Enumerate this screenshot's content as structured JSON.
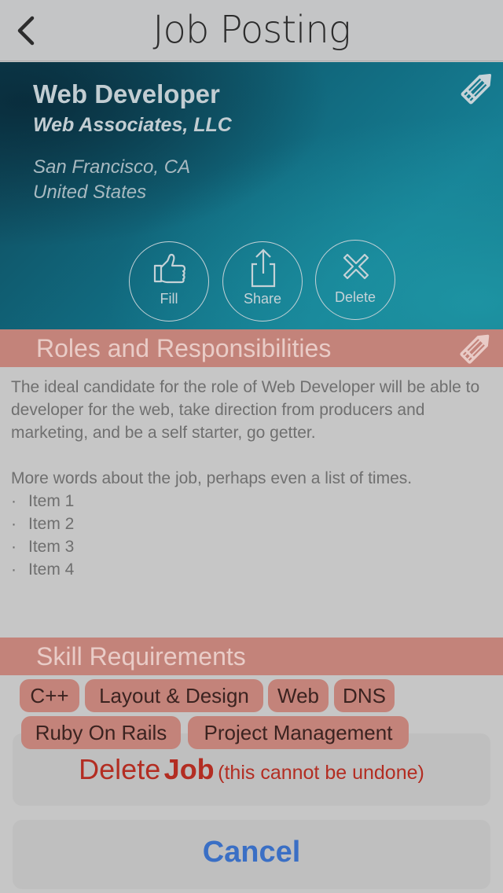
{
  "nav": {
    "title": "Job Posting",
    "back_icon": "chevron-left-icon"
  },
  "job": {
    "title": "Web Developer",
    "company": "Web Associates, LLC",
    "city": "San Francisco, CA",
    "country": "United States",
    "edit_icon": "pencil-icon"
  },
  "actions": [
    {
      "label": "Fill",
      "icon": "thumbs-up-icon"
    },
    {
      "label": "Share",
      "icon": "share-icon"
    },
    {
      "label": "Delete",
      "icon": "close-icon"
    }
  ],
  "roles": {
    "heading": "Roles and Responsibilities",
    "paragraph1": "The ideal candidate for the role of Web Developer will be able to developer for the web, take direction from producers and marketing, and be a self starter, go getter.",
    "paragraph2": "More words about the job, perhaps even a list of times.",
    "bullet": "·",
    "items": [
      "Item 1",
      "Item 2",
      "Item 3",
      "Item 4"
    ]
  },
  "skills": {
    "heading": "Skill Requirements",
    "chips": [
      "C++",
      "Layout & Design",
      "Web",
      "DNS",
      "Ruby On Rails",
      "Project Management"
    ]
  },
  "sheet": {
    "delete_prefix": "Delete",
    "delete_bold": "Job",
    "delete_note": "(this cannot be undone)",
    "cancel": "Cancel"
  },
  "colors": {
    "accent_salmon": "#c3837a",
    "hero_teal": "#11697e",
    "destructive_red": "#b32d22",
    "cancel_blue": "#3a6fc5"
  }
}
